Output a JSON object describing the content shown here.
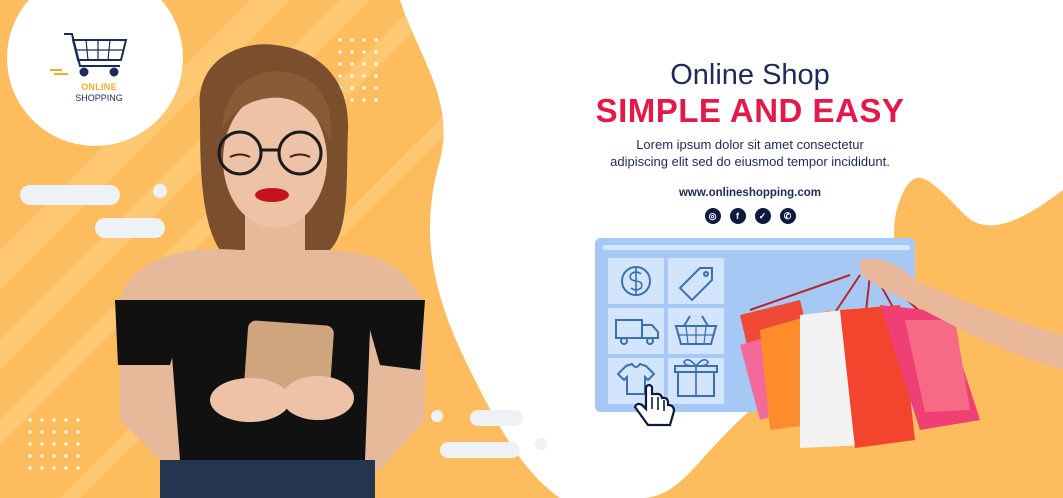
{
  "logo": {
    "line1": "ONLINE",
    "line2": "SHOPPING",
    "icon": "shopping-cart-icon"
  },
  "heading": {
    "small": "Online Shop",
    "big": "SIMPLE AND EASY"
  },
  "description": {
    "line1": "Lorem ipsum dolor sit amet consectetur",
    "line2": "adipiscing elit sed do eiusmod tempor incididunt."
  },
  "website": "www.onlineshopping.com",
  "social_icons": [
    "instagram-icon",
    "facebook-icon",
    "twitter-icon",
    "whatsapp-icon"
  ],
  "colors": {
    "background_orange": "#fdbd5e",
    "navy": "#1c2b57",
    "accent_red": "#e3194a",
    "panel_blue": "#a6c8f4"
  },
  "screen_tiles": [
    "dollar-icon",
    "price-tag-icon",
    "delivery-truck-icon",
    "basket-icon",
    "tshirt-icon",
    "gift-box-icon"
  ]
}
